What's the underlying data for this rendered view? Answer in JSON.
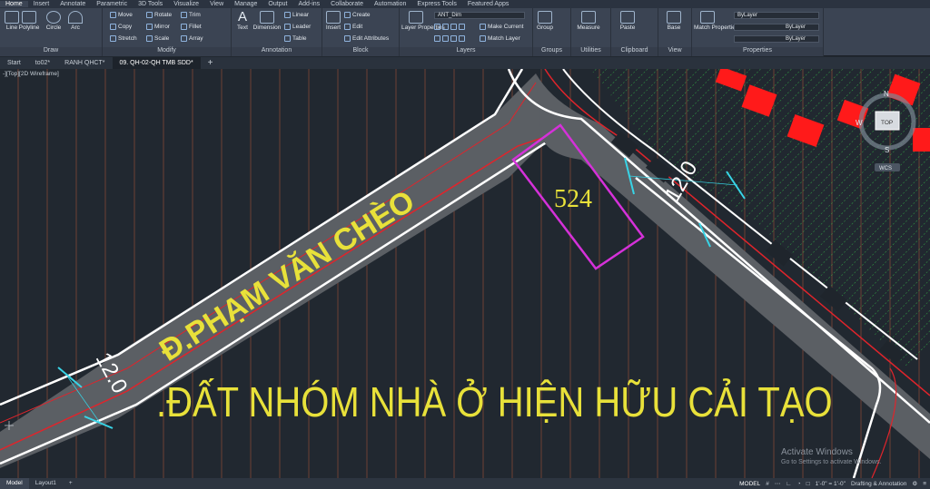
{
  "menu_tabs": [
    "Home",
    "Insert",
    "Annotate",
    "Parametric",
    "3D Tools",
    "Visualize",
    "View",
    "Manage",
    "Output",
    "Add-ins",
    "Collaborate",
    "Automation",
    "Express Tools",
    "Featured Apps"
  ],
  "ribbon": {
    "draw": {
      "title": "Draw",
      "line": "Line",
      "polyline": "Polyline",
      "circle": "Circle",
      "arc": "Arc"
    },
    "modify": {
      "title": "Modify",
      "move": "Move",
      "rotate": "Rotate",
      "trim": "Trim",
      "copy": "Copy",
      "mirror": "Mirror",
      "fillet": "Fillet",
      "stretch": "Stretch",
      "scale": "Scale",
      "array": "Array"
    },
    "annotation": {
      "title": "Annotation",
      "text": "Text",
      "dimension": "Dimension",
      "linear": "Linear",
      "leader": "Leader",
      "table": "Table"
    },
    "block": {
      "title": "Block",
      "insert": "Insert",
      "create": "Create",
      "edit": "Edit",
      "edit_attributes": "Edit Attributes"
    },
    "layers": {
      "title": "Layers",
      "layer_properties": "Layer Properties",
      "current_layer": "ANT_Dim",
      "make_current": "Make Current",
      "match_layer": "Match Layer"
    },
    "groups": {
      "title": "Groups",
      "group": "Group"
    },
    "utilities": {
      "title": "Utilities",
      "measure": "Measure"
    },
    "clipboard": {
      "title": "Clipboard",
      "paste": "Paste"
    },
    "view": {
      "title": "View",
      "base": "Base"
    },
    "properties": {
      "title": "Properties",
      "match": "Match Properties",
      "color": "ByLayer",
      "linetype": "ByLayer",
      "lineweight": "ByLayer"
    }
  },
  "doc_tabs": [
    "Start",
    "to02*",
    "RANH QHCT*",
    "09. QH-02-QH TMB SDD*"
  ],
  "viewport_label": "-][Top][2D Wireframe]",
  "drawing": {
    "street_name": "Đ.PHẠM VĂN CHÈO",
    "area_label": ".ĐẤT NHÓM NHÀ Ở HIỆN HỮU CẢI TẠO",
    "lot_number": "524",
    "road_width_left": "12.0",
    "road_width_right": "12.0",
    "viewcube_n": "N",
    "viewcube_w": "W",
    "viewcube_s": "S",
    "viewcube_top": "TOP",
    "viewcube_wcs": "WCS",
    "colors": {
      "road_fill": "#5b5f64",
      "road_edge": "#ffffff",
      "red_line": "#e0242b",
      "magenta": "#d531d9",
      "yellow_text": "#e8e13a",
      "hatch": "#37c24a",
      "grid": "#c0563c",
      "cyan": "#38d4e6",
      "red_block": "#ff1a1a"
    }
  },
  "statusbar": {
    "model_tab": "Model",
    "layout_tab": "Layout1",
    "model_mode": "MODEL",
    "scale": "1'-0\" = 1'-0\"",
    "workspace": "Drafting & Annotation"
  },
  "watermark": {
    "title": "Activate Windows",
    "sub": "Go to Settings to activate Windows."
  }
}
